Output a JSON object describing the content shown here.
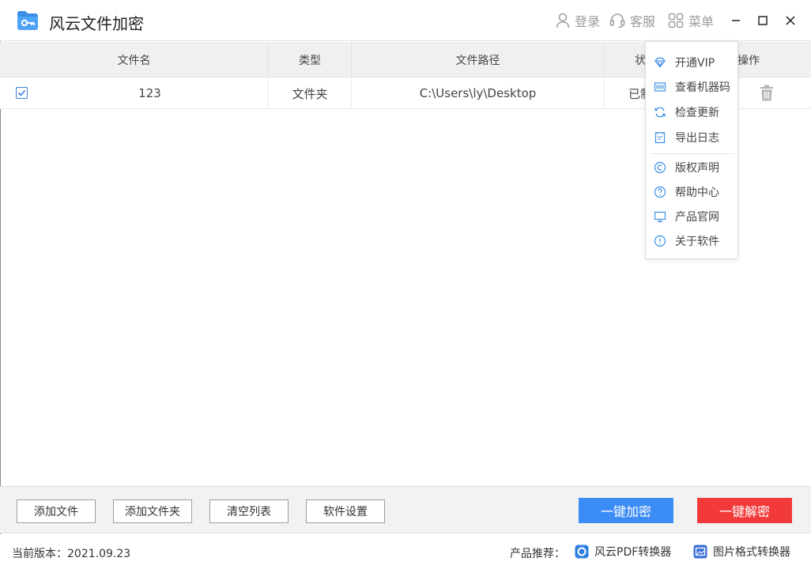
{
  "app": {
    "title": "风云文件加密",
    "brand_color": "#3a8ee6"
  },
  "titlebar": {
    "login_label": "登录",
    "service_label": "客服",
    "menu_label": "菜单"
  },
  "table": {
    "columns": [
      "文件名",
      "类型",
      "文件路径",
      "状",
      "操作"
    ],
    "rows": [
      {
        "name": "123",
        "type": "文件夹",
        "path": "C:\\Users\\ly\\Desktop",
        "status": "已制",
        "checked": true
      }
    ]
  },
  "menu": {
    "items": [
      {
        "label": "开通VIP",
        "icon": "diamond-icon"
      },
      {
        "label": "查看机器码",
        "icon": "barcode-icon"
      },
      {
        "label": "检查更新",
        "icon": "refresh-icon"
      },
      {
        "label": "导出日志",
        "icon": "log-icon"
      },
      {
        "label": "版权声明",
        "icon": "copyright-icon"
      },
      {
        "label": "帮助中心",
        "icon": "help-icon"
      },
      {
        "label": "产品官网",
        "icon": "monitor-icon"
      },
      {
        "label": "关于软件",
        "icon": "info-icon"
      }
    ]
  },
  "toolbar": {
    "add_file": "添加文件",
    "add_folder": "添加文件夹",
    "clear_list": "清空列表",
    "settings": "软件设置",
    "encrypt": "一键加密",
    "decrypt": "一键解密",
    "encrypt_color": "#3b8cf5",
    "decrypt_color": "#f23a3a"
  },
  "status": {
    "version": "当前版本：2021.09.23",
    "recommend_label": "产品推荐：",
    "pdf_link": "风云PDF转换器",
    "image_link": "图片格式转换器"
  }
}
